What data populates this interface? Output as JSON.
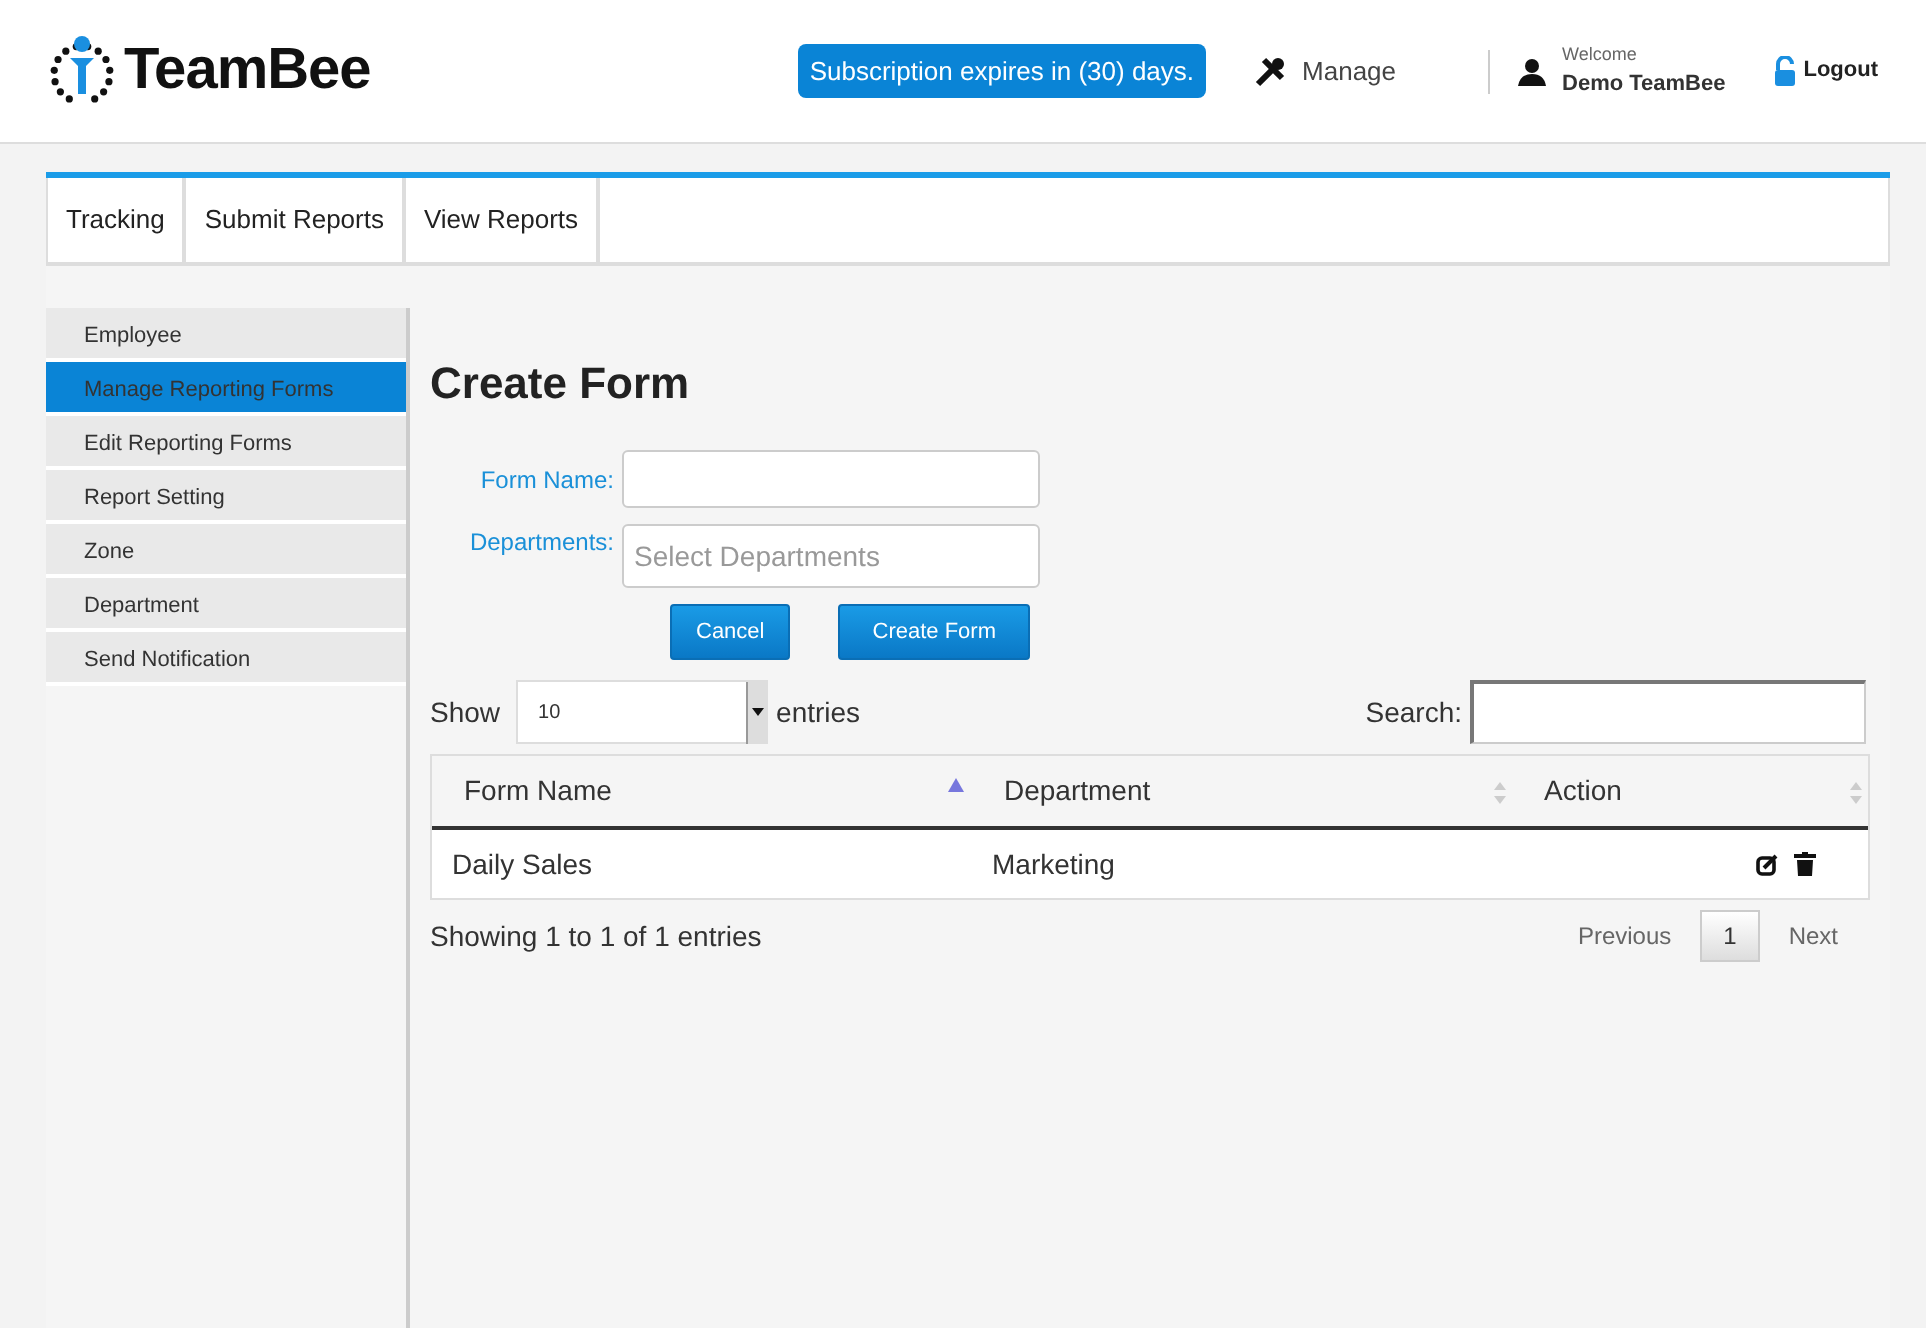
{
  "header": {
    "logo": "TeamBee",
    "subscription": "Subscription expires in (30) days.",
    "manage": "Manage",
    "welcome": "Welcome",
    "user": "Demo TeamBee",
    "logout": "Logout"
  },
  "tabs": [
    {
      "label": "Tracking",
      "selected": false
    },
    {
      "label": "Submit Reports",
      "selected": false
    },
    {
      "label": "View Reports",
      "selected": false
    }
  ],
  "sidebar": {
    "items": [
      {
        "label": "Employee",
        "selected": false
      },
      {
        "label": "Manage Reporting Forms",
        "selected": true
      },
      {
        "label": "Edit Reporting Forms",
        "selected": false
      },
      {
        "label": "Report Setting",
        "selected": false
      },
      {
        "label": "Zone",
        "selected": false
      },
      {
        "label": "Department",
        "selected": false
      },
      {
        "label": "Send Notification",
        "selected": false
      }
    ]
  },
  "form": {
    "title": "Create Form",
    "fields": [
      {
        "label": "Form Name:",
        "kind": "text"
      },
      {
        "label": "Departments:",
        "kind": "select",
        "placeholder": "Select Departments"
      }
    ],
    "buttons": [
      "Cancel",
      "Create Form"
    ]
  },
  "table": {
    "show_label": "Show",
    "page_size": "10",
    "entries_label": "entries",
    "search_label": "Search:",
    "columns": [
      {
        "label": "Form Name",
        "sorted": true
      },
      {
        "label": "Department",
        "sorted": false
      },
      {
        "label": "Action",
        "sorted": false
      }
    ],
    "rows": [
      {
        "form_name": "Daily Sales",
        "department": "Marketing"
      }
    ],
    "info": "Showing 1 to 1 of 1 entries",
    "pagination": [
      {
        "label": "Previous",
        "selected": false
      },
      {
        "label": "1",
        "selected": true
      },
      {
        "label": "Next",
        "selected": false
      }
    ]
  }
}
